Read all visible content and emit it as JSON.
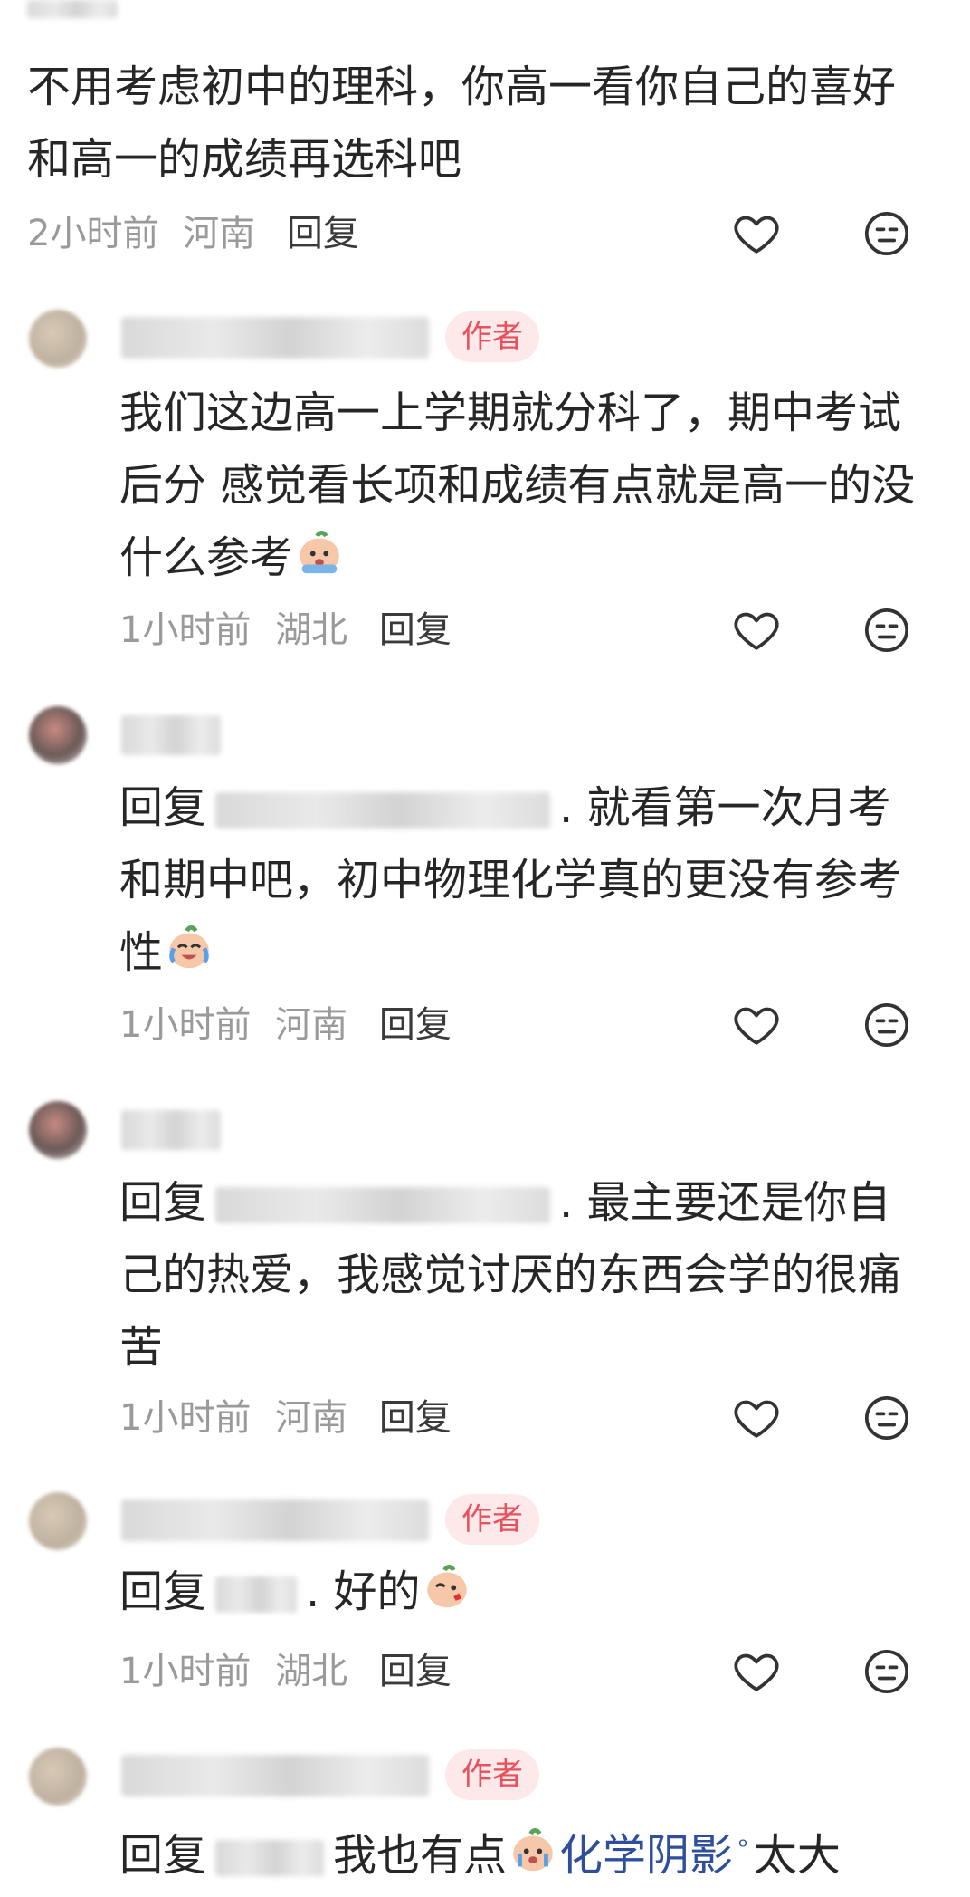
{
  "comments": [
    {
      "text": "不用考虑初中的理科，你高一看你自己的喜好和高一的成绩再选科吧",
      "line1": "不用考虑初中的理科，你高一看你自己的喜好",
      "line2": "和高一的成绩再选科吧",
      "time": "2小时前",
      "location": "河南",
      "reply_label": "回复"
    },
    {
      "tag": "作者",
      "line1": "我们这边高一上学期就分科了，期中考试",
      "line2": "后分 感觉看长项和成绩有点就是高一的没",
      "line3": "什么参考",
      "time": "1小时前",
      "location": "湖北",
      "reply_label": "回复"
    },
    {
      "reply_prefix": "回复",
      "line1_tail": ". 就看第一次月考",
      "line2": "和期中吧，初中物理化学真的更没有参考",
      "line3": "性",
      "time": "1小时前",
      "location": "河南",
      "reply_label": "回复"
    },
    {
      "reply_prefix": "回复",
      "line1_tail": ". 最主要还是你自",
      "line2": "己的热爱，我感觉讨厌的东西会学的很痛",
      "line3": "苦",
      "time": "1小时前",
      "location": "河南",
      "reply_label": "回复"
    },
    {
      "tag": "作者",
      "reply_prefix": "回复",
      "line1_tail": ". 好的",
      "time": "1小时前",
      "location": "湖北",
      "reply_label": "回复"
    },
    {
      "tag": "作者",
      "reply_prefix": "回复",
      "line1_mid": "我也有点",
      "link_text": "化学阴影",
      "line1_tail": "太大"
    }
  ],
  "icons": {
    "like": "heart-outline-icon",
    "dislike": "neutral-face-icon",
    "search_link": "search-icon"
  },
  "colors": {
    "author_tag_bg": "#fde8ea",
    "author_tag_text": "#e8505b",
    "meta_text": "#9a9a9a",
    "link": "#2f4f9c"
  }
}
